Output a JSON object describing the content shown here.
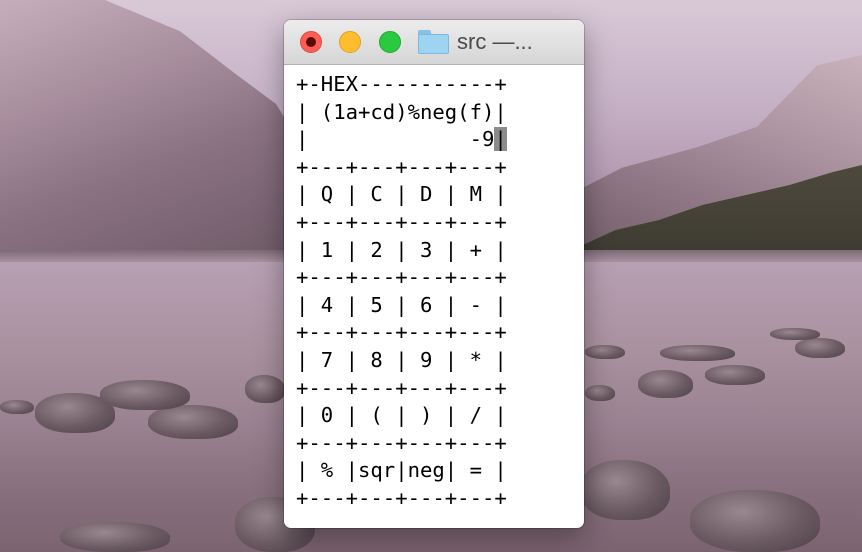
{
  "window": {
    "title": "src —..."
  },
  "terminal": {
    "lines": [
      "+-HEX-----------+",
      "| (1a+cd)%neg(f)|",
      "|             -9",
      "+---+---+---+---+",
      "| Q | C | D | M |",
      "+---+---+---+---+",
      "| 1 | 2 | 3 | + |",
      "+---+---+---+---+",
      "| 4 | 5 | 6 | - |",
      "+---+---+---+---+",
      "| 7 | 8 | 9 | * |",
      "+---+---+---+---+",
      "| 0 | ( | ) | / |",
      "+---+---+---+---+",
      "| % |sqr|neg| = |",
      "+---+---+---+---+"
    ],
    "cursor_char": "|"
  },
  "colors": {
    "close": "#fd5f57",
    "minimize": "#febd2e",
    "zoom": "#29c940",
    "folder": "#9fd3f2"
  },
  "icons": [
    "close-icon",
    "minimize-icon",
    "zoom-icon",
    "folder-icon"
  ]
}
